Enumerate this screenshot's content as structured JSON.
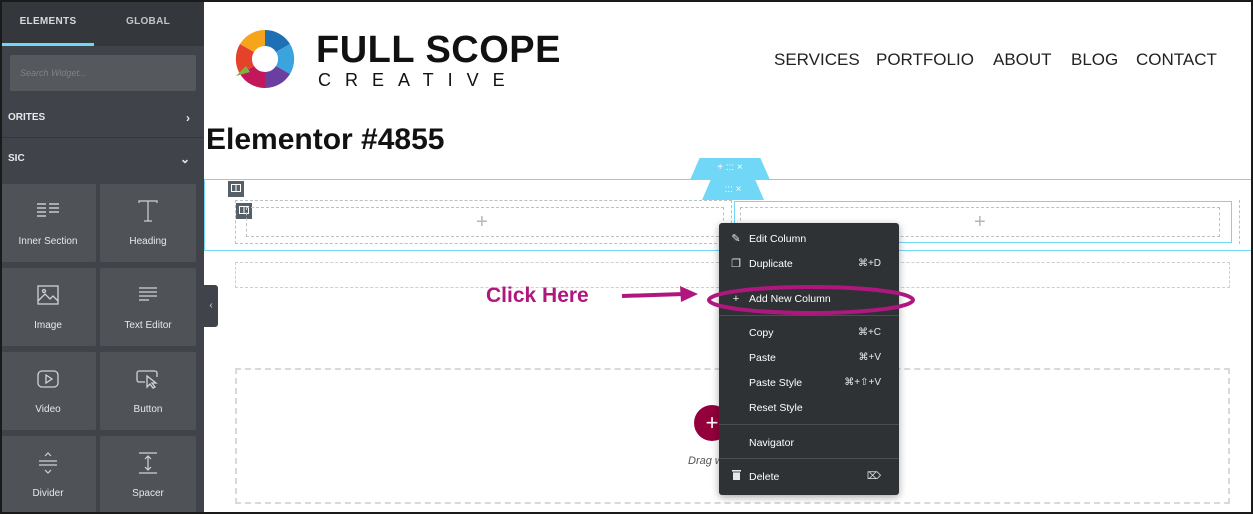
{
  "sidebar": {
    "tabs": [
      "ELEMENTS",
      "GLOBAL"
    ],
    "search_placeholder": "Search Widget...",
    "categories": [
      {
        "label": "ORITES",
        "chevron": "›"
      },
      {
        "label": "SIC",
        "chevron": "⌄"
      }
    ],
    "widgets": [
      {
        "label": "Inner Section",
        "icon": "inner-section-icon"
      },
      {
        "label": "Heading",
        "icon": "heading-icon"
      },
      {
        "label": "Image",
        "icon": "image-icon"
      },
      {
        "label": "Text Editor",
        "icon": "text-editor-icon"
      },
      {
        "label": "Video",
        "icon": "video-icon"
      },
      {
        "label": "Button",
        "icon": "button-icon"
      },
      {
        "label": "Divider",
        "icon": "divider-icon"
      },
      {
        "label": "Spacer",
        "icon": "spacer-icon"
      }
    ],
    "collapse_glyph": "‹"
  },
  "site": {
    "logo_line1": "FULL SCOPE",
    "logo_line2": "CREATIVE",
    "nav": [
      "SERVICES",
      "PORTFOLIO",
      "ABOUT",
      "BLOG",
      "CONTACT"
    ]
  },
  "page_title": "Elementor #4855",
  "editor": {
    "section_handle": "+ ::: ×",
    "column_handle": "::: ×",
    "column_plus": "+",
    "add_button": "+",
    "drag_text": "Drag w"
  },
  "context_menu": {
    "items": [
      {
        "label": "Edit Column",
        "shortcut": "",
        "icon": "pencil-icon",
        "glyph": "✎"
      },
      {
        "label": "Duplicate",
        "shortcut": "⌘+D",
        "icon": "duplicate-icon",
        "glyph": "❐"
      },
      {
        "label": "Add New Column",
        "shortcut": "",
        "icon": "plus-icon",
        "glyph": "+"
      },
      {
        "label": "Copy",
        "shortcut": "⌘+C",
        "icon": "",
        "glyph": ""
      },
      {
        "label": "Paste",
        "shortcut": "⌘+V",
        "icon": "",
        "glyph": ""
      },
      {
        "label": "Paste Style",
        "shortcut": "⌘+⇧+V",
        "icon": "",
        "glyph": ""
      },
      {
        "label": "Reset Style",
        "shortcut": "",
        "icon": "",
        "glyph": ""
      },
      {
        "label": "Navigator",
        "shortcut": "",
        "icon": "",
        "glyph": ""
      },
      {
        "label": "Delete",
        "shortcut": "⌦",
        "icon": "trash-icon",
        "glyph": "🗑"
      }
    ]
  },
  "annotation": {
    "text": "Click Here",
    "color": "#b0177e"
  },
  "colors": {
    "sidebar_bg": "#404349",
    "accent": "#71d7f7",
    "add_button": "#93003c",
    "menu_bg": "#2f3235"
  }
}
